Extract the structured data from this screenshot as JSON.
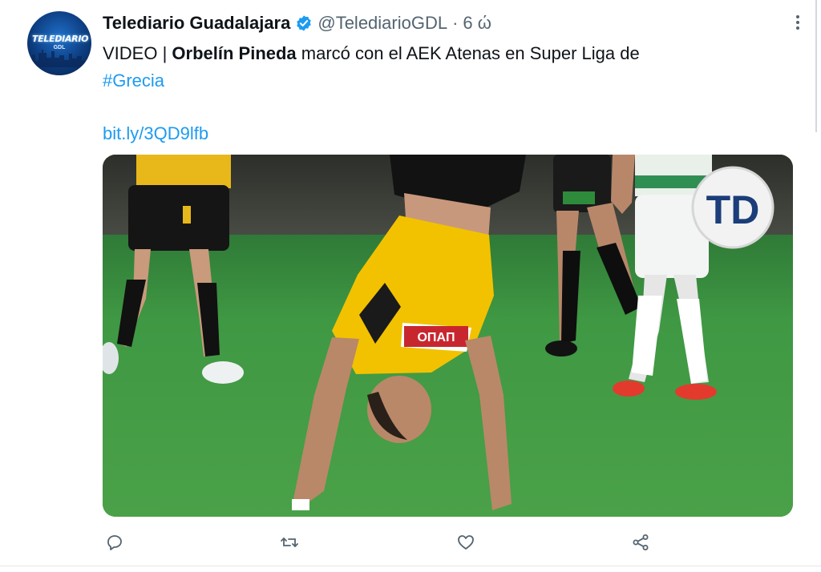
{
  "tweet": {
    "author_name": "Telediario Guadalajara",
    "handle": "@TelediarioGDL",
    "separator": "·",
    "time": "6 ώ",
    "avatar": {
      "logo_text": "TELEDIARIO",
      "logo_sub": "GDL"
    },
    "text": {
      "prefix": "VIDEO | ",
      "bold": "Orbelín Pineda",
      "suffix": " marcó con el AEK Atenas en Super Liga de ",
      "hashtag": "#Grecia"
    },
    "link": "bit.ly/3QD9lfb",
    "media": {
      "sponsor_text": "ΟΠΑΠ",
      "watermark": "TD"
    }
  },
  "icons": {
    "more": "more-vertical-icon",
    "verified": "verified-badge-icon",
    "reply": "reply-icon",
    "retweet": "retweet-icon",
    "like": "heart-icon",
    "share": "share-icon"
  },
  "colors": {
    "accent": "#1d9bf0",
    "secondary_text": "#536471",
    "primary_text": "#0f1419",
    "pitch_green": "#3a8e3e",
    "jersey_yellow": "#f2c200"
  }
}
